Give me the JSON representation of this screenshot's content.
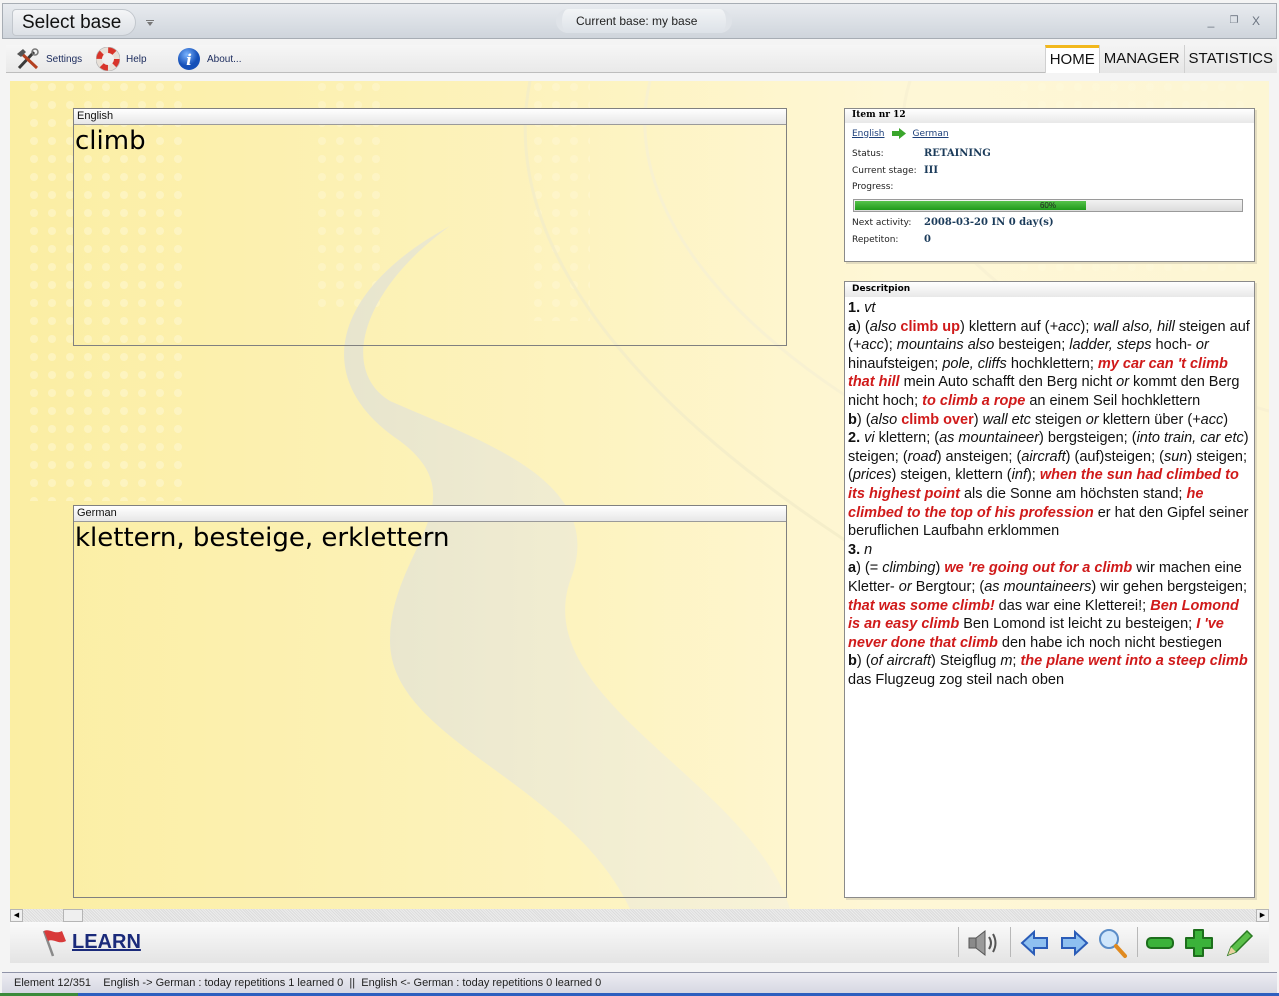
{
  "titlebar": {
    "select_base_label": "Select base",
    "current_base": "Current base: my base",
    "window_controls": {
      "minimize": "_",
      "restore": "❐",
      "close": "X"
    }
  },
  "toolbar": {
    "items": [
      {
        "label": "Settings",
        "icon": "tools-icon"
      },
      {
        "label": "Help",
        "icon": "lifebuoy-icon"
      },
      {
        "label": "About...",
        "icon": "info-icon"
      }
    ],
    "tabs": [
      {
        "label": "HOME",
        "active": true
      },
      {
        "label": "MANAGER",
        "active": false
      },
      {
        "label": "STATISTICS",
        "active": false
      }
    ]
  },
  "question": {
    "language": "English",
    "word": "climb"
  },
  "answer": {
    "language": "German",
    "word": "klettern, besteige, erklettern"
  },
  "item_info": {
    "title": "Item nr 12",
    "from_language": "English",
    "to_language": "German",
    "status_label": "Status:",
    "status": "RETAINING",
    "stage_label": "Current stage:",
    "stage": "III",
    "progress_label": "Progress:",
    "progress_percent": 60,
    "progress_text": "60%",
    "next_activity_label": "Next activity:",
    "next_activity": "2008-03-20 IN 0 day(s)",
    "repetition_label": "Repetiton:",
    "repetition": "0",
    "colors": {
      "progress_fill": "#2fa82a",
      "value_text": "#1b3b5a"
    }
  },
  "description": {
    "title": "Descritpion",
    "highlight_color": "#d01a1a",
    "segments": [
      {
        "t": "1.",
        "s": "n"
      },
      {
        "t": " "
      },
      {
        "t": "vt",
        "s": "i"
      },
      {
        "br": true
      },
      {
        "t": "a",
        "s": "n"
      },
      {
        "t": ") ("
      },
      {
        "t": "also",
        "s": "i"
      },
      {
        "t": " "
      },
      {
        "t": "climb up",
        "s": "r"
      },
      {
        "t": ") klettern auf ("
      },
      {
        "t": "+acc",
        "s": "i"
      },
      {
        "t": "); "
      },
      {
        "t": "wall also, hill",
        "s": "i"
      },
      {
        "t": " steigen auf ("
      },
      {
        "t": "+acc",
        "s": "i"
      },
      {
        "t": "); "
      },
      {
        "t": "mountains also",
        "s": "i"
      },
      {
        "t": " besteigen; "
      },
      {
        "t": "ladder, steps",
        "s": "i"
      },
      {
        "t": " hoch- "
      },
      {
        "t": "or",
        "s": "i"
      },
      {
        "t": " hinaufsteigen; "
      },
      {
        "t": "pole, cliffs",
        "s": "i"
      },
      {
        "t": " hochklettern; "
      },
      {
        "t": "my car can 't climb that hill",
        "s": "ri"
      },
      {
        "t": " mein Auto schafft den Berg nicht "
      },
      {
        "t": "or",
        "s": "i"
      },
      {
        "t": " kommt den Berg nicht hoch; "
      },
      {
        "t": "to climb a rope",
        "s": "ri"
      },
      {
        "t": " an einem Seil hochklettern"
      },
      {
        "br": true
      },
      {
        "t": "b",
        "s": "n"
      },
      {
        "t": ") ("
      },
      {
        "t": "also",
        "s": "i"
      },
      {
        "t": " "
      },
      {
        "t": "climb over",
        "s": "r"
      },
      {
        "t": ") "
      },
      {
        "t": "wall etc",
        "s": "i"
      },
      {
        "t": " steigen "
      },
      {
        "t": "or",
        "s": "i"
      },
      {
        "t": " klettern über ("
      },
      {
        "t": "+acc",
        "s": "i"
      },
      {
        "t": ")"
      },
      {
        "br": true
      },
      {
        "t": "2.",
        "s": "n"
      },
      {
        "t": " "
      },
      {
        "t": "vi",
        "s": "i"
      },
      {
        "t": " klettern; ("
      },
      {
        "t": "as mountaineer",
        "s": "i"
      },
      {
        "t": ") bergsteigen; ("
      },
      {
        "t": "into train, car etc",
        "s": "i"
      },
      {
        "t": ") steigen; ("
      },
      {
        "t": "road",
        "s": "i"
      },
      {
        "t": ") ansteigen; ("
      },
      {
        "t": "aircraft",
        "s": "i"
      },
      {
        "t": ") (auf)steigen; ("
      },
      {
        "t": "sun",
        "s": "i"
      },
      {
        "t": ") steigen; ("
      },
      {
        "t": "prices",
        "s": "i"
      },
      {
        "t": ") steigen, klettern ("
      },
      {
        "t": "inf",
        "s": "i"
      },
      {
        "t": "); "
      },
      {
        "t": "when the sun had climbed to its highest point",
        "s": "ri"
      },
      {
        "t": " als die Sonne am höchsten stand; "
      },
      {
        "t": "he climbed to the top of his profession",
        "s": "ri"
      },
      {
        "t": " er hat den Gipfel seiner beruflichen Laufbahn erklommen"
      },
      {
        "br": true
      },
      {
        "t": "3.",
        "s": "n"
      },
      {
        "t": " "
      },
      {
        "t": "n",
        "s": "i"
      },
      {
        "br": true
      },
      {
        "t": "a",
        "s": "n"
      },
      {
        "t": ") (= "
      },
      {
        "t": "climbing",
        "s": "i"
      },
      {
        "t": ") "
      },
      {
        "t": "we 're going out for a climb",
        "s": "ri"
      },
      {
        "t": " wir machen eine Kletter- "
      },
      {
        "t": "or",
        "s": "i"
      },
      {
        "t": " Bergtour; ("
      },
      {
        "t": "as mountaineers",
        "s": "i"
      },
      {
        "t": ") wir gehen bergsteigen; "
      },
      {
        "t": "that was some climb!",
        "s": "ri"
      },
      {
        "t": " das war eine Kletterei!; "
      },
      {
        "t": "Ben Lomond is an easy climb",
        "s": "ri"
      },
      {
        "t": " Ben Lomond ist leicht zu besteigen; "
      },
      {
        "t": "I 've never done that climb",
        "s": "ri"
      },
      {
        "t": " den habe ich noch nicht bestiegen"
      },
      {
        "br": true
      },
      {
        "t": "b",
        "s": "n"
      },
      {
        "t": ") ("
      },
      {
        "t": "of aircraft",
        "s": "i"
      },
      {
        "t": ") Steigflug "
      },
      {
        "t": "m",
        "s": "i"
      },
      {
        "t": "; "
      },
      {
        "t": "the plane went into a steep climb",
        "s": "ri"
      },
      {
        "t": " das Flugzeug zog steil nach oben"
      }
    ]
  },
  "bottombar": {
    "learn_label": "LEARN",
    "icons": [
      "speaker-icon",
      "previous-arrow-icon",
      "next-arrow-icon",
      "search-icon",
      "remove-icon",
      "add-icon",
      "edit-pencil-icon"
    ]
  },
  "statusbar": {
    "element": "Element 12/351",
    "stats": "English -> German : today repetitions 1 learned 0  ||  English <- German : today repetitions 0 learned 0"
  }
}
